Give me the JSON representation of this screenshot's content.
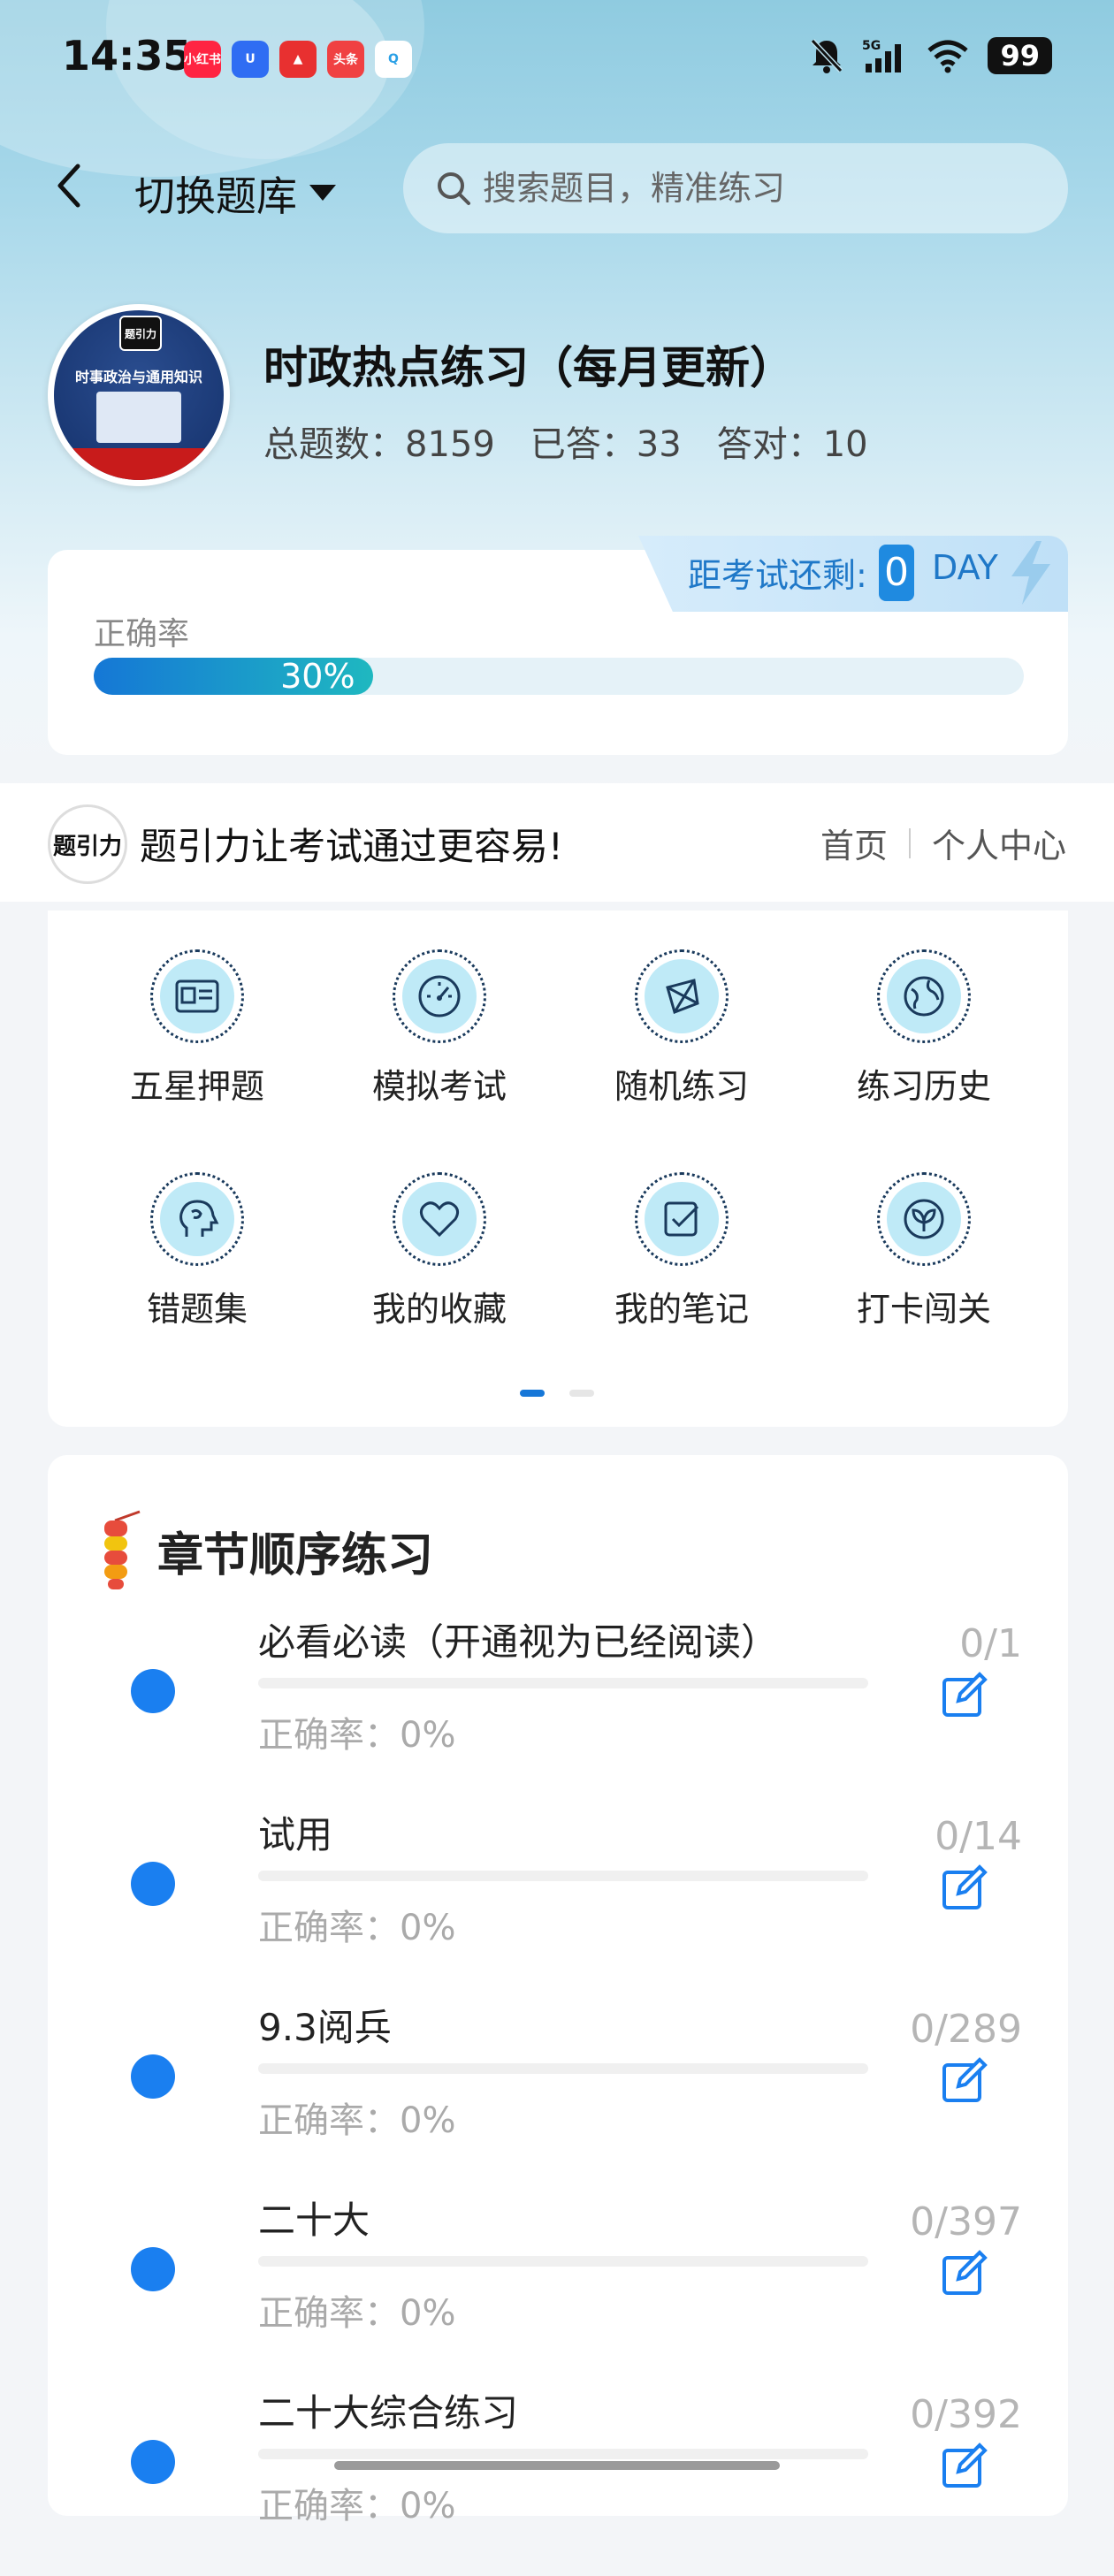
{
  "status_bar": {
    "time": "14:35",
    "battery": "99",
    "app_icons": [
      "小红书",
      "U",
      "▲",
      "头条",
      "Q"
    ]
  },
  "header": {
    "switch_label": "切换题库",
    "search_placeholder": "搜索题目，精准练习"
  },
  "bank": {
    "cover_title": "时事政治与通用知识",
    "cover_logo": "题引力",
    "title": "时政热点练习（每月更新）",
    "total": "总题数：8159",
    "answered": "已答：33",
    "correct": "答对：10"
  },
  "countdown": {
    "label": "距考试还剩:",
    "days": "0",
    "unit": "DAY"
  },
  "accuracy": {
    "label": "正确率",
    "percent_text": "30%",
    "value": 0.3
  },
  "brand": {
    "logo": "题引力",
    "slogan": "题引力让考试通过更容易!",
    "nav_home": "首页",
    "nav_profile": "个人中心"
  },
  "functions": [
    {
      "label": "五星押题",
      "icon": "id-card-icon"
    },
    {
      "label": "模拟考试",
      "icon": "speedometer-icon"
    },
    {
      "label": "随机练习",
      "icon": "random-icon"
    },
    {
      "label": "练习历史",
      "icon": "globe-icon"
    },
    {
      "label": "错题集",
      "icon": "head-icon"
    },
    {
      "label": "我的收藏",
      "icon": "heart-icon"
    },
    {
      "label": "我的笔记",
      "icon": "note-check-icon"
    },
    {
      "label": "打卡闯关",
      "icon": "leaf-icon"
    }
  ],
  "chapters": {
    "title": "章节顺序练习",
    "items": [
      {
        "name": "必看必读（开通视为已经阅读）",
        "accuracy": "正确率：0%",
        "count": "0/1"
      },
      {
        "name": "试用",
        "accuracy": "正确率：0%",
        "count": "0/14"
      },
      {
        "name": "9.3阅兵",
        "accuracy": "正确率：0%",
        "count": "0/289"
      },
      {
        "name": "二十大",
        "accuracy": "正确率：0%",
        "count": "0/397"
      },
      {
        "name": "二十大综合练习",
        "accuracy": "正确率：0%",
        "count": "0/392"
      }
    ]
  },
  "colors": {
    "accent": "#1a7ff0",
    "progress_start": "#1577d6",
    "progress_end": "#1fb8c0",
    "countdown_text": "#1f78c8"
  }
}
